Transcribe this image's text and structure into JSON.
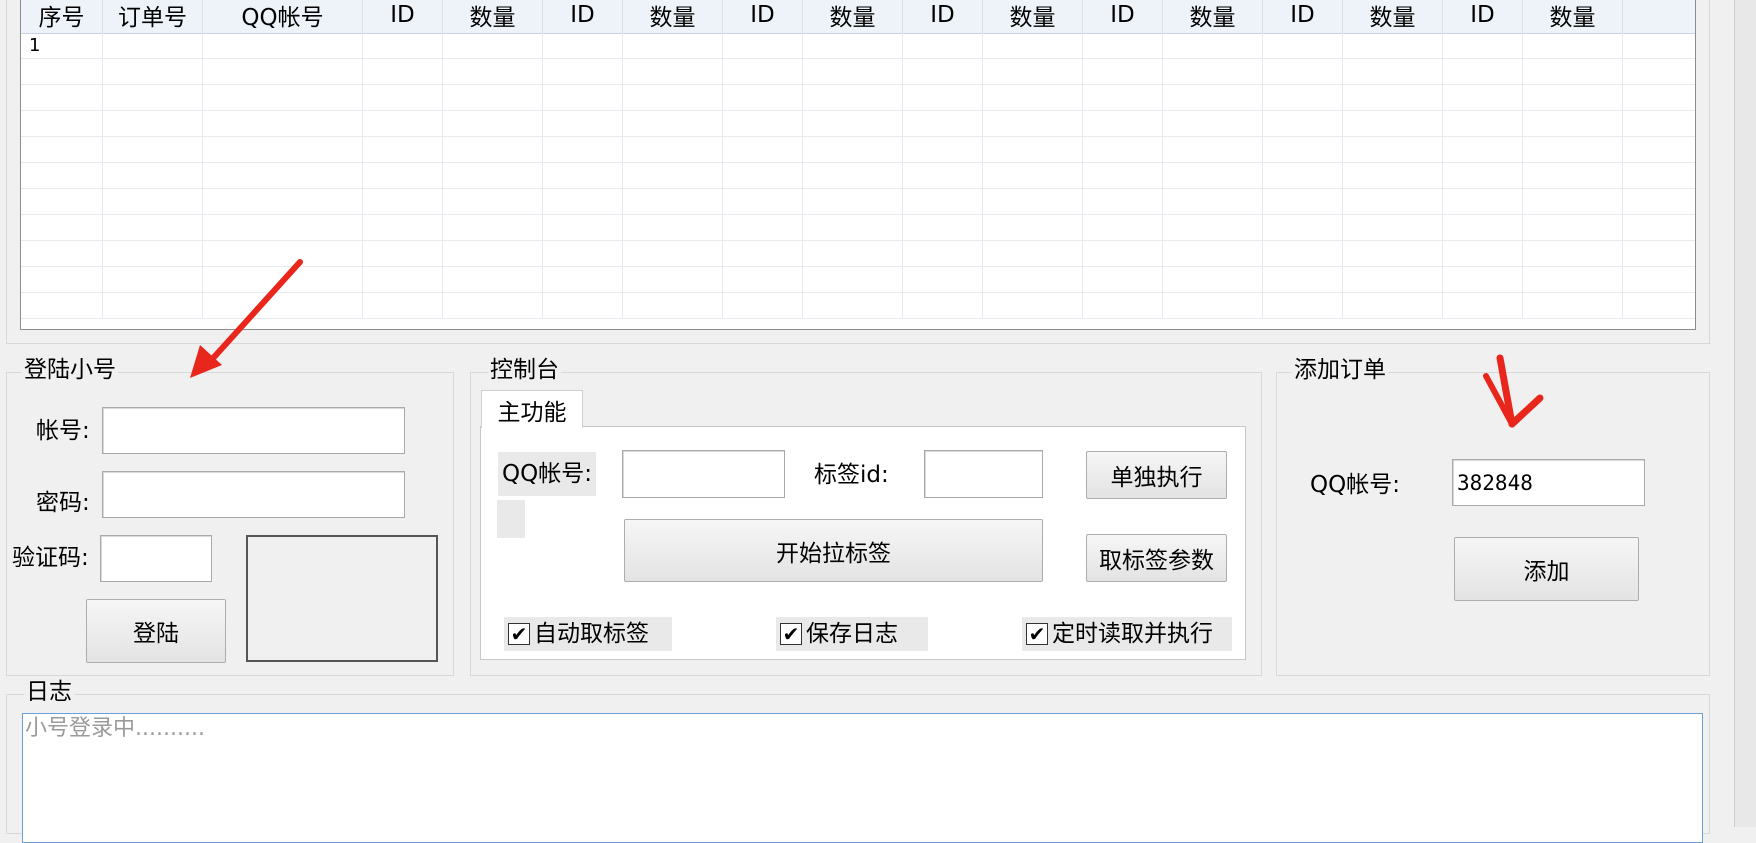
{
  "grid": {
    "columns": [
      "序号",
      "订单号",
      "QQ帐号",
      "ID",
      "数量",
      "ID",
      "数量",
      "ID",
      "数量",
      "ID",
      "数量",
      "ID",
      "数量",
      "ID",
      "数量",
      "ID",
      "数量",
      ""
    ],
    "rows": [
      [
        "1",
        "",
        "",
        "",
        "",
        "",
        "",
        "",
        "",
        "",
        "",
        "",
        "",
        "",
        "",
        "",
        "",
        ""
      ],
      [
        "",
        "",
        "",
        "",
        "",
        "",
        "",
        "",
        "",
        "",
        "",
        "",
        "",
        "",
        "",
        "",
        "",
        ""
      ],
      [
        "",
        "",
        "",
        "",
        "",
        "",
        "",
        "",
        "",
        "",
        "",
        "",
        "",
        "",
        "",
        "",
        "",
        ""
      ],
      [
        "",
        "",
        "",
        "",
        "",
        "",
        "",
        "",
        "",
        "",
        "",
        "",
        "",
        "",
        "",
        "",
        "",
        ""
      ],
      [
        "",
        "",
        "",
        "",
        "",
        "",
        "",
        "",
        "",
        "",
        "",
        "",
        "",
        "",
        "",
        "",
        "",
        ""
      ],
      [
        "",
        "",
        "",
        "",
        "",
        "",
        "",
        "",
        "",
        "",
        "",
        "",
        "",
        "",
        "",
        "",
        "",
        ""
      ],
      [
        "",
        "",
        "",
        "",
        "",
        "",
        "",
        "",
        "",
        "",
        "",
        "",
        "",
        "",
        "",
        "",
        "",
        ""
      ],
      [
        "",
        "",
        "",
        "",
        "",
        "",
        "",
        "",
        "",
        "",
        "",
        "",
        "",
        "",
        "",
        "",
        "",
        ""
      ],
      [
        "",
        "",
        "",
        "",
        "",
        "",
        "",
        "",
        "",
        "",
        "",
        "",
        "",
        "",
        "",
        "",
        "",
        ""
      ],
      [
        "",
        "",
        "",
        "",
        "",
        "",
        "",
        "",
        "",
        "",
        "",
        "",
        "",
        "",
        "",
        "",
        "",
        ""
      ],
      [
        "",
        "",
        "",
        "",
        "",
        "",
        "",
        "",
        "",
        "",
        "",
        "",
        "",
        "",
        "",
        "",
        "",
        ""
      ]
    ]
  },
  "login": {
    "title": "登陆小号",
    "account_label": "帐号:",
    "account_value": "",
    "password_label": "密码:",
    "password_value": "",
    "captcha_label": "验证码:",
    "captcha_value": "",
    "login_button": "登陆"
  },
  "console": {
    "title": "控制台",
    "tab_label": "主功能",
    "qq_label": "QQ帐号:",
    "qq_value": "",
    "tag_label": "标签id:",
    "tag_value": "",
    "run_single_button": "单独执行",
    "start_button": "开始拉标签",
    "get_params_button": "取标签参数",
    "auto_tag_label": "自动取标签",
    "auto_tag_checked": true,
    "save_log_label": "保存日志",
    "save_log_checked": true,
    "timed_label": "定时读取并执行",
    "timed_checked": true,
    "check_mark": "✔"
  },
  "add_order": {
    "title": "添加订单",
    "qq_label": "QQ帐号:",
    "qq_value": "382848",
    "add_button": "添加"
  },
  "log": {
    "title": "日志",
    "text": "小号登录中.........."
  },
  "colors": {
    "annotation_arrow": "#e8261b",
    "log_border": "#6a9fd8"
  }
}
